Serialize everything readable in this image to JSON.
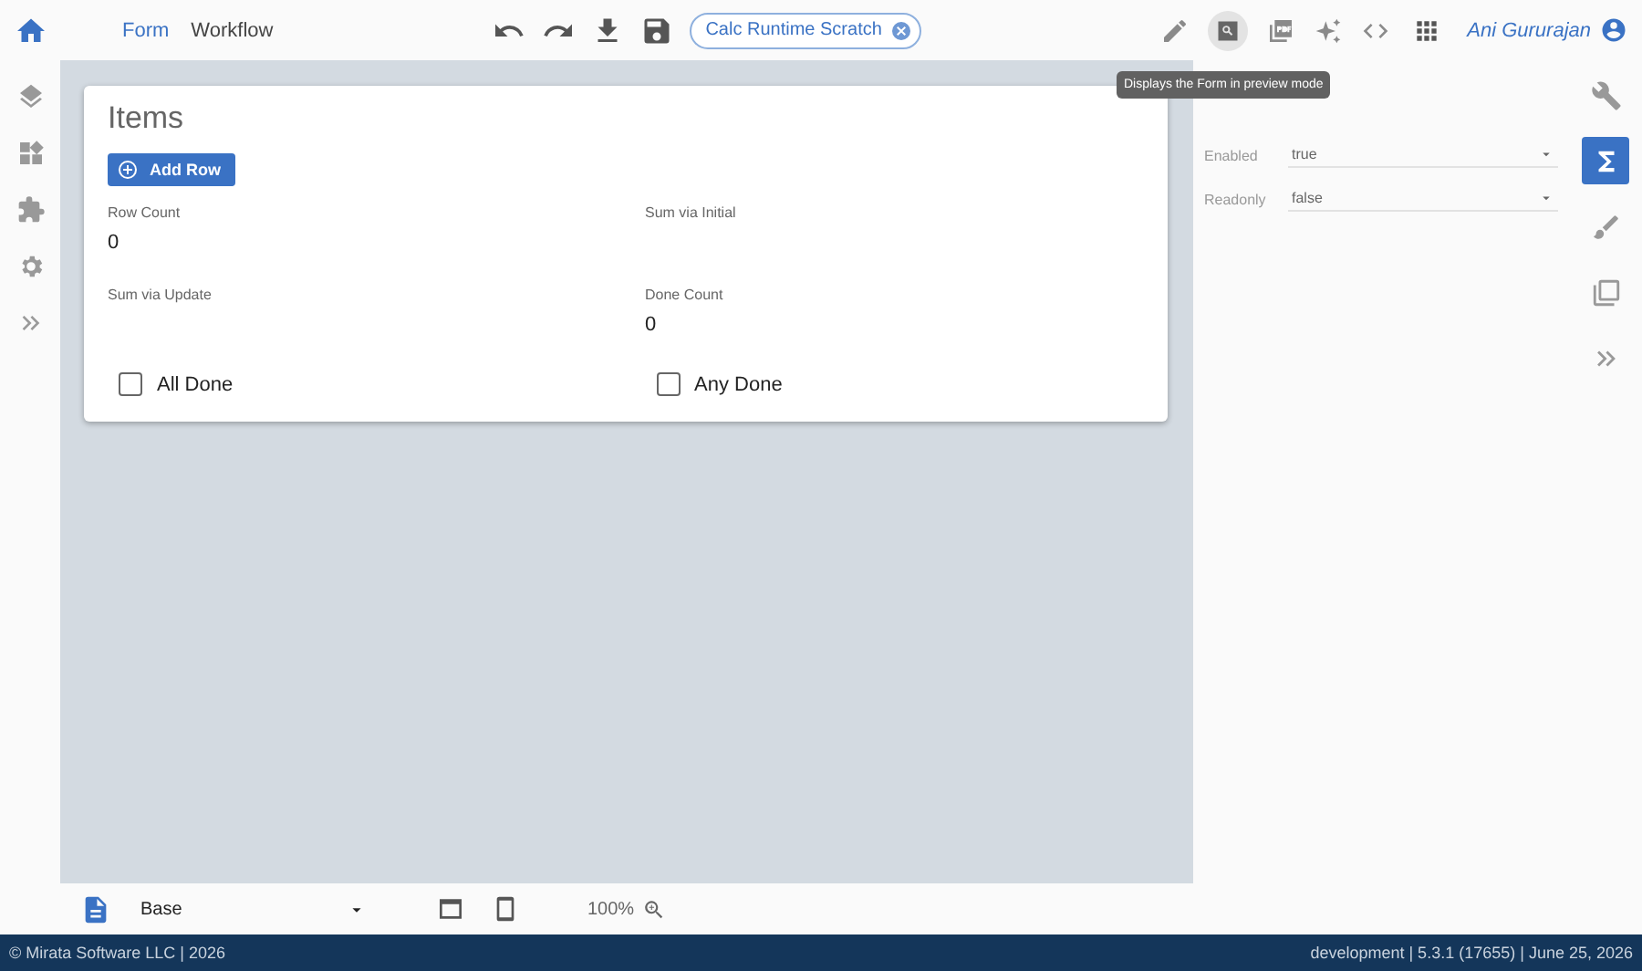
{
  "top_bar": {
    "tabs": [
      {
        "label": "Form",
        "selected": true
      },
      {
        "label": "Workflow",
        "selected": false
      }
    ],
    "document_chip": {
      "label": "Calc Runtime Scratch"
    },
    "tools": [
      {
        "kind": "pencil",
        "selected": false
      },
      {
        "kind": "preview",
        "selected": true
      },
      {
        "kind": "pdf",
        "selected": false
      },
      {
        "kind": "sparkle",
        "selected": false
      },
      {
        "kind": "code",
        "selected": false
      }
    ],
    "user": {
      "name": "Ani Gururajan"
    },
    "tooltip": "Displays the Form in preview mode"
  },
  "left_rail": [
    {
      "kind": "layers"
    },
    {
      "kind": "widgets"
    },
    {
      "kind": "puzzle"
    },
    {
      "kind": "gear"
    },
    {
      "kind": "expand"
    }
  ],
  "form": {
    "title": "Items",
    "add_button": "Add Row",
    "fields": [
      {
        "label": "Row Count",
        "value": "0"
      },
      {
        "label": "Sum via Initial"
      },
      {
        "label": "Sum via Update"
      },
      {
        "label": "Done Count",
        "value": "0"
      }
    ],
    "checkboxes": [
      {
        "label": "All Done",
        "checked": false
      },
      {
        "label": "Any Done",
        "checked": false
      }
    ]
  },
  "properties": {
    "fields": [
      {
        "label": "Enabled",
        "value": "true"
      },
      {
        "label": "Readonly",
        "value": "false"
      }
    ]
  },
  "right_rail": [
    {
      "kind": "wrench",
      "selected": false
    },
    {
      "kind": "sigma",
      "selected": true
    },
    {
      "kind": "brush",
      "selected": false
    },
    {
      "kind": "copy",
      "selected": false
    },
    {
      "kind": "expand",
      "selected": false
    }
  ],
  "bottom_bar": {
    "view": "Base",
    "zoom": "100%"
  },
  "footer": {
    "left": "© Mirata Software LLC | 2026",
    "right": "development | 5.3.1 (17655) | June 25, 2026"
  }
}
